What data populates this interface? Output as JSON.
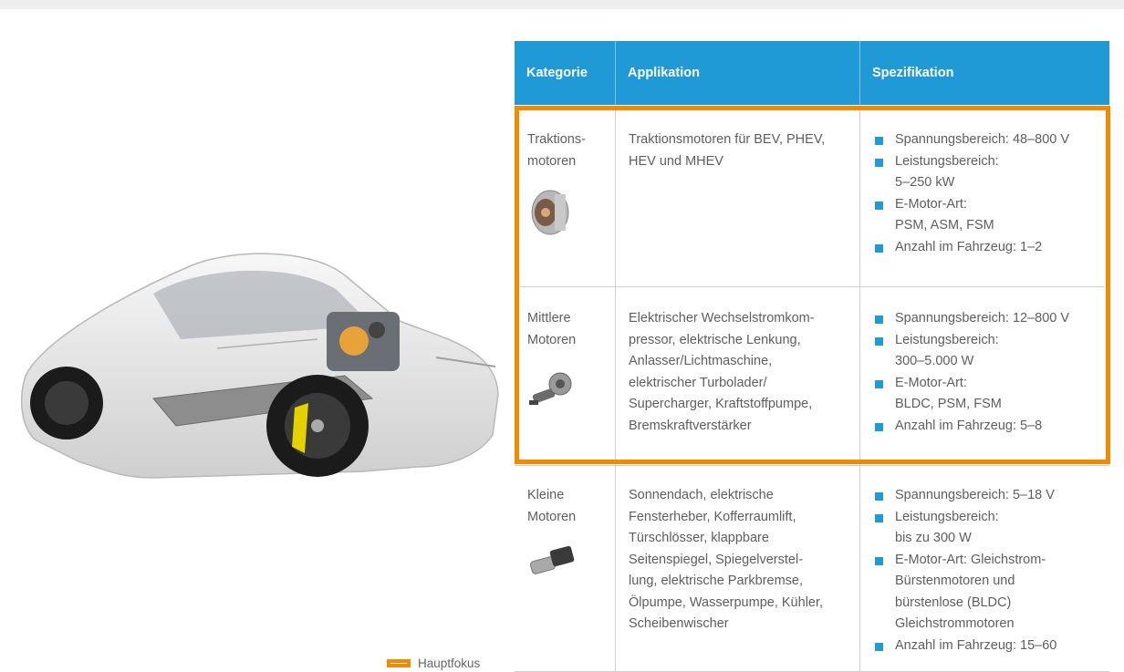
{
  "legend": {
    "label": "Hauptfokus",
    "color": "#f08a00"
  },
  "colors": {
    "header": "#1f9ad6",
    "focus": "#f08a00",
    "bullet": "#1f9ad6"
  },
  "table": {
    "headers": [
      "Kategorie",
      "Applikation",
      "Spezifikation"
    ],
    "rows": [
      {
        "category": [
          "Traktions-",
          "motoren"
        ],
        "application": [
          "Traktionsmotoren für BEV, PHEV,",
          "HEV und MHEV"
        ],
        "spec": [
          [
            "Spannungsbereich: 48–800 V"
          ],
          [
            "Leistungsbereich:",
            "5–250 kW"
          ],
          [
            "E-Motor-Art:",
            "PSM, ASM, FSM"
          ],
          [
            "Anzahl im Fahrzeug: 1–2"
          ]
        ],
        "icon": "traction-motor-image"
      },
      {
        "category": [
          "Mittlere",
          "Motoren"
        ],
        "application": [
          "Elektrischer Wechselstromkom-",
          "pressor, elektrische Lenkung,",
          "Anlasser/Lichtmaschine,",
          "elektrischer Turbolader/",
          "Supercharger, Kraftstoffpumpe,",
          "Bremskraftverstärker"
        ],
        "spec": [
          [
            "Spannungsbereich: 12–800 V"
          ],
          [
            "Leistungsbereich:",
            "300–5.000 W"
          ],
          [
            "E-Motor-Art:",
            "BLDC, PSM, FSM"
          ],
          [
            "Anzahl im Fahrzeug: 5–8"
          ]
        ],
        "icon": "medium-motor-image"
      },
      {
        "category": [
          "Kleine",
          "Motoren"
        ],
        "application": [
          "Sonnendach, elektrische",
          "Fensterheber, Kofferraumlift,",
          "Türschlösser, klappbare",
          "Seitenspiegel, Spiegelverstel-",
          "lung, elektrische Parkbremse,",
          "Ölpumpe, Wasserpumpe, Kühler,",
          "Scheibenwischer"
        ],
        "spec": [
          [
            "Spannungsbereich: 5–18 V"
          ],
          [
            "Leistungsbereich:",
            "bis zu 300 W"
          ],
          [
            "E-Motor-Art: Gleichstrom-",
            "Bürstenmotoren und",
            "bürstenlose (BLDC)",
            "Gleichstrommotoren"
          ],
          [
            "Anzahl im Fahrzeug: 15–60"
          ]
        ],
        "icon": "small-motor-image"
      }
    ]
  }
}
